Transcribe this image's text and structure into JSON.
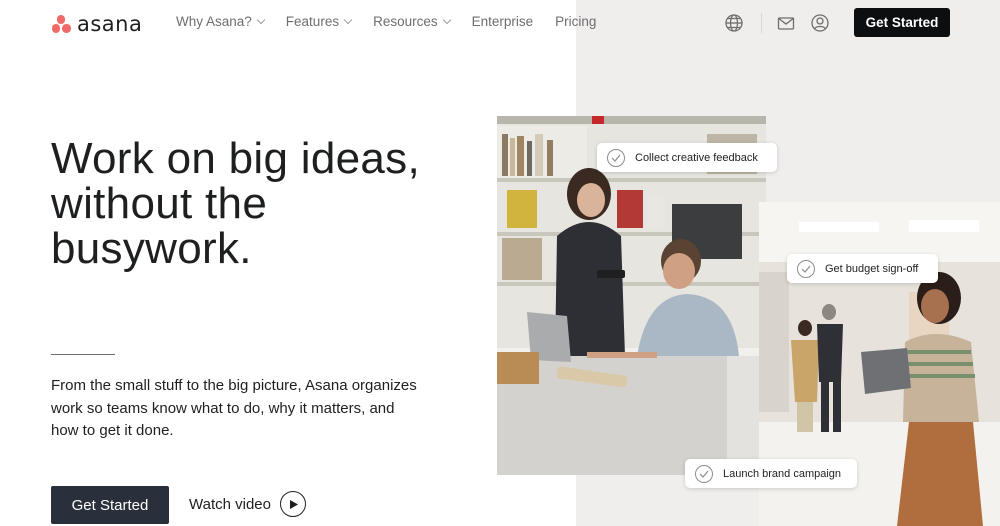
{
  "header": {
    "logo_text": "asana",
    "nav": [
      {
        "label": "Why Asana?",
        "dropdown": true
      },
      {
        "label": "Features",
        "dropdown": true
      },
      {
        "label": "Resources",
        "dropdown": true
      },
      {
        "label": "Enterprise",
        "dropdown": false
      },
      {
        "label": "Pricing",
        "dropdown": false
      }
    ],
    "icons": [
      "globe-icon",
      "mail-icon",
      "user-account-icon"
    ],
    "cta_label": "Get Started"
  },
  "hero": {
    "title_lines": [
      "Work on big ideas,",
      "without the",
      "busywork."
    ],
    "description": "From the small stuff to the big picture, Asana organizes work so teams know what to do, why it matters, and how to get it done.",
    "primary_cta": "Get Started",
    "secondary_cta": "Watch video"
  },
  "task_cards": [
    {
      "label": "Collect creative feedback"
    },
    {
      "label": "Get budget sign-off"
    },
    {
      "label": "Launch brand campaign"
    }
  ],
  "colors": {
    "brand_coral": "#f06a6a",
    "dark_button": "#0d0e10",
    "hero_button": "#2a303b",
    "right_panel_bg": "#f0eded"
  }
}
